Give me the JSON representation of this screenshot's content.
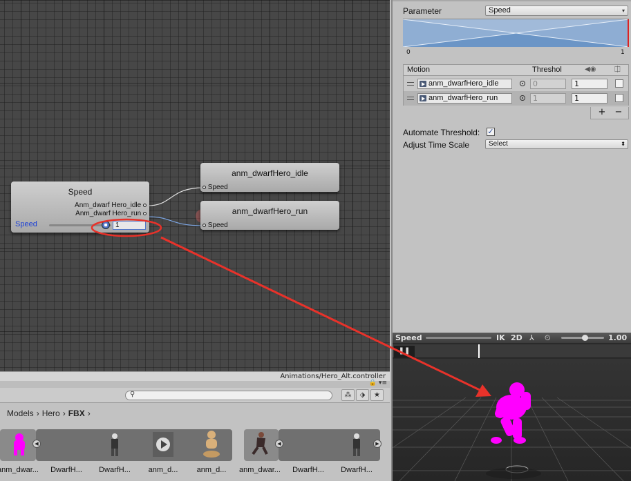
{
  "graph": {
    "speed_node": {
      "title": "Speed",
      "out_idle": "Anm_dwarf Hero_idle",
      "out_run": "Anm_dwarf Hero_run",
      "param_label": "Speed",
      "param_value": "1"
    },
    "idle_node": {
      "title": "anm_dwarfHero_idle",
      "input_label": "Speed"
    },
    "run_node": {
      "title": "anm_dwarfHero_run",
      "input_label": "Speed"
    },
    "status_path": "Animations/Hero_Alt.controller"
  },
  "project": {
    "search_placeholder": "",
    "breadcrumb": [
      "Models",
      "Hero",
      "FBX"
    ],
    "assets": [
      {
        "caption": "anm_dwar...",
        "icon": "pink-hero-icon"
      },
      {
        "caption": "DwarfH...",
        "icon": "dwarf-mesh-icon"
      },
      {
        "caption": "DwarfH...",
        "icon": "dwarf-mesh-icon"
      },
      {
        "caption": "anm_d...",
        "icon": "play-clip-icon"
      },
      {
        "caption": "anm_d...",
        "icon": "avatar-icon"
      },
      {
        "caption": "anm_dwar...",
        "icon": "running-figure-icon"
      },
      {
        "caption": "DwarfH...",
        "icon": "dwarf-mesh-icon"
      },
      {
        "caption": "DwarfH...",
        "icon": "dwarf-mesh-icon"
      }
    ]
  },
  "inspector": {
    "parameter_label": "Parameter",
    "parameter_value": "Speed",
    "blend_min": "0",
    "blend_max": "1",
    "table": {
      "col_motion": "Motion",
      "col_threshold": "Threshol",
      "rows": [
        {
          "motion": "anm_dwarfHero_idle",
          "threshold": "0",
          "speed": "1"
        },
        {
          "motion": "anm_dwarfHero_run",
          "threshold": "1",
          "speed": "1"
        }
      ],
      "add_label": "+",
      "remove_label": "−"
    },
    "automate_threshold_label": "Automate Threshold",
    "automate_threshold_checked": true,
    "adjust_time_scale_label": "Adjust Time Scale",
    "adjust_time_scale_value": "Select"
  },
  "preview": {
    "param_label": "Speed",
    "ik_label": "IK",
    "mode_2d_label": "2D",
    "speed_value": "1.00",
    "speed_fraction": 0.55,
    "timeline_fraction": 0.36,
    "character_color": "#ff00ff"
  },
  "colors": {
    "annotation": "#e8322a",
    "blend_fill": "#5d88bb",
    "param_blue": "#1a3fd6"
  }
}
